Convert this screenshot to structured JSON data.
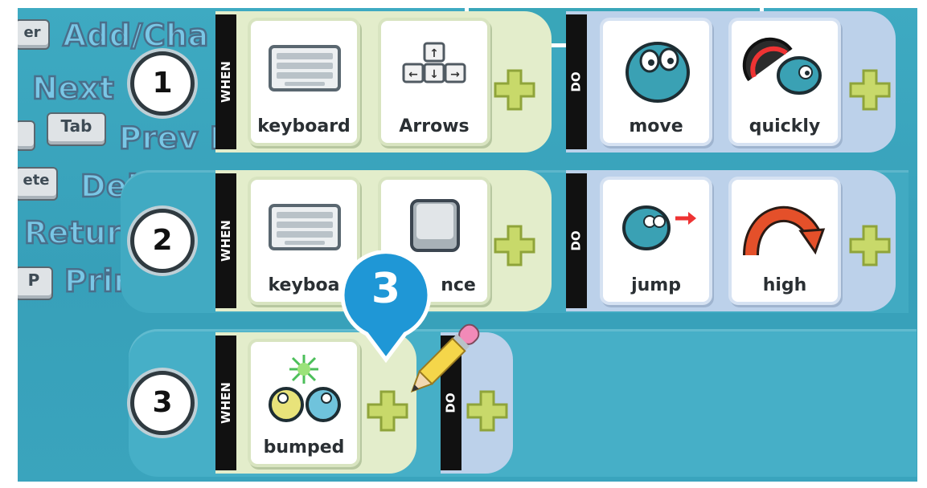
{
  "help_menu": {
    "items": [
      {
        "key": "er",
        "text": "Add/Cha"
      },
      {
        "key": "",
        "text": "Next"
      },
      {
        "key": "Tab",
        "text": "Prev Pa"
      },
      {
        "key": "ete",
        "text": "Delete T"
      },
      {
        "key": "",
        "text": "Retur"
      },
      {
        "key": "P",
        "text": "Print Koc"
      }
    ]
  },
  "rules": [
    {
      "number": "1",
      "when_label": "WHEN",
      "do_label": "DO",
      "when_tiles": [
        {
          "label": "keyboard",
          "icon": "keyboard-icon"
        },
        {
          "label": "Arrows",
          "icon": "arrow-keys-icon"
        }
      ],
      "do_tiles": [
        {
          "label": "move",
          "icon": "kodu-move-icon"
        },
        {
          "label": "quickly",
          "icon": "speedometer-icon"
        }
      ]
    },
    {
      "number": "2",
      "when_label": "WHEN",
      "do_label": "DO",
      "when_tiles": [
        {
          "label": "keyboa",
          "icon": "keyboard-icon"
        },
        {
          "label": "nce",
          "icon": "space-key-icon"
        }
      ],
      "do_tiles": [
        {
          "label": "jump",
          "icon": "kodu-jump-icon"
        },
        {
          "label": "high",
          "icon": "curved-arrow-icon"
        }
      ]
    },
    {
      "number": "3",
      "when_label": "WHEN",
      "do_label": "DO",
      "when_tiles": [
        {
          "label": "bumped",
          "icon": "bumped-icon"
        }
      ],
      "do_tiles": []
    }
  ],
  "callout": {
    "text": "3",
    "color": "#1f97d6"
  },
  "colors": {
    "background": "#3ba5bd",
    "when_panel": "#e3edcb",
    "do_panel": "#bcd1ea",
    "plus": "#c8d96a",
    "label_bar": "#111111"
  }
}
